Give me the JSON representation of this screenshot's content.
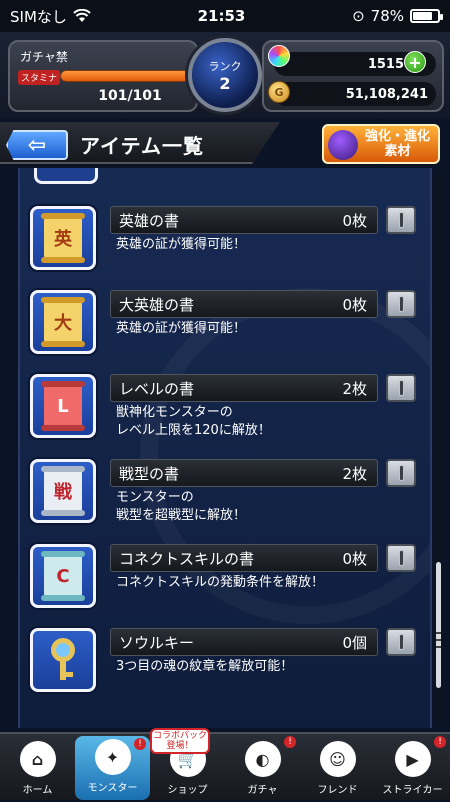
{
  "status_bar": {
    "carrier": "SIMなし",
    "time": "21:53",
    "battery": "78%",
    "battery_level": 0.78
  },
  "header": {
    "player_name": "ガチャ禁",
    "stamina_label": "スタミナ",
    "stamina_text": "101/101",
    "stamina_fraction": 1.0,
    "rank_label": "ランク",
    "rank_value": "2",
    "orbs": "1515",
    "orb_plus": "+",
    "gold": "51,108,241"
  },
  "titlebar": {
    "back_icon": "⇦",
    "title": "アイテム一覧",
    "evo_button": "強化・進化\n素材"
  },
  "items": [
    {
      "name": "英雄の書",
      "qty": "0枚",
      "desc": "英雄の証が獲得可能！",
      "icon": "scroll-gold-icon",
      "glyph": "英",
      "style": "gold"
    },
    {
      "name": "大英雄の書",
      "qty": "0枚",
      "desc": "英雄の証が獲得可能！",
      "icon": "scroll-gold-icon",
      "glyph": "大",
      "style": "gold"
    },
    {
      "name": "レベルの書",
      "qty": "2枚",
      "desc": "獣神化モンスターの\nレベル上限を120に解放！",
      "icon": "scroll-red-icon",
      "glyph": "L",
      "style": "red"
    },
    {
      "name": "戦型の書",
      "qty": "2枚",
      "desc": "モンスターの\n戦型を超戦型に解放！",
      "icon": "scroll-white-icon",
      "glyph": "戦",
      "style": "white"
    },
    {
      "name": "コネクトスキルの書",
      "qty": "0枚",
      "desc": "コネクトスキルの発動条件を解放！",
      "icon": "scroll-teal-icon",
      "glyph": "C",
      "style": "teal"
    },
    {
      "name": "ソウルキー",
      "qty": "0個",
      "desc": "3つ目の魂の紋章を解放可能！",
      "icon": "key-icon",
      "glyph": "",
      "style": "key"
    }
  ],
  "nav": [
    {
      "label": "ホーム",
      "icon": "home-icon",
      "glyph": "⌂",
      "active": false,
      "badge": false
    },
    {
      "label": "モンスター",
      "icon": "monster-icon",
      "glyph": "✦",
      "active": true,
      "badge": true
    },
    {
      "label": "ショップ",
      "icon": "cart-icon",
      "glyph": "🛒",
      "active": false,
      "badge": false,
      "tag": "コラボパック\n登場！"
    },
    {
      "label": "ガチャ",
      "icon": "gacha-icon",
      "glyph": "◐",
      "active": false,
      "badge": true
    },
    {
      "label": "フレンド",
      "icon": "friend-icon",
      "glyph": "☺",
      "active": false,
      "badge": false
    },
    {
      "label": "ストライカー",
      "icon": "striker-icon",
      "glyph": "▶",
      "active": false,
      "badge": true
    }
  ],
  "colors": {
    "accent_blue": "#1d5ecf",
    "stamina_orange": "#e35a0b",
    "content_bg": "#172a52",
    "badge_red": "#d2252a"
  }
}
